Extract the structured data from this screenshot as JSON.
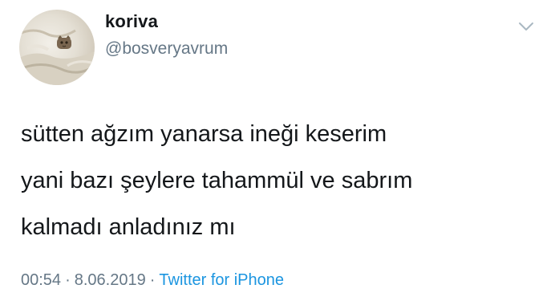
{
  "user": {
    "display_name": "koriva",
    "handle": "@bosveryavrum"
  },
  "tweet": {
    "lines": [
      "sütten ağzım yanarsa ineği keserim",
      "yani bazı şeylere tahammül ve sabrım",
      "kalmadı anladınız mı"
    ],
    "time": "00:54",
    "separator": "·",
    "date": "8.06.2019",
    "source": "Twitter for iPhone"
  },
  "icons": {
    "menu": "chevron-down-icon",
    "avatar": "cat-photo-avatar"
  },
  "colors": {
    "text": "#14171a",
    "secondary": "#657786",
    "link": "#1b95e0"
  }
}
